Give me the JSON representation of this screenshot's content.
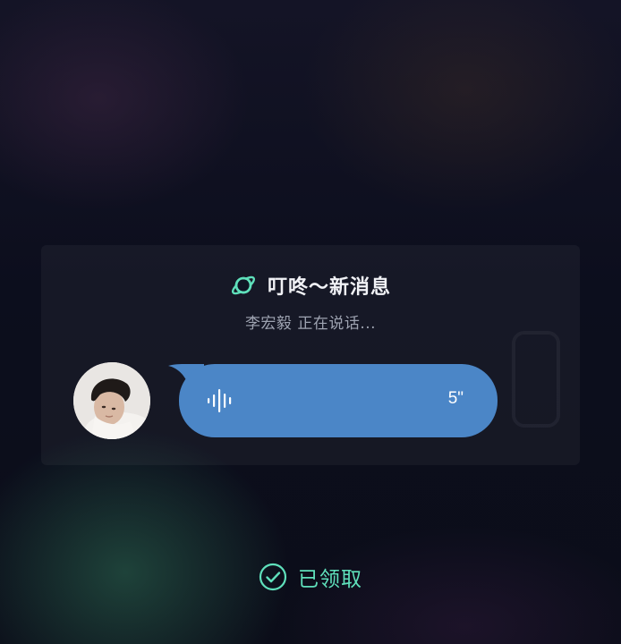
{
  "card": {
    "title": "叮咚～新消息",
    "subtitle": "李宏毅 正在说话...",
    "title_icon": "planet-icon",
    "accent_color": "#5fe0bb"
  },
  "voice_message": {
    "duration": "5\"",
    "bubble_color": "#4b86c7",
    "icon": "sound-wave-icon"
  },
  "status": {
    "label": "已领取",
    "icon": "check-circle-icon",
    "color": "#5fe0bb"
  }
}
